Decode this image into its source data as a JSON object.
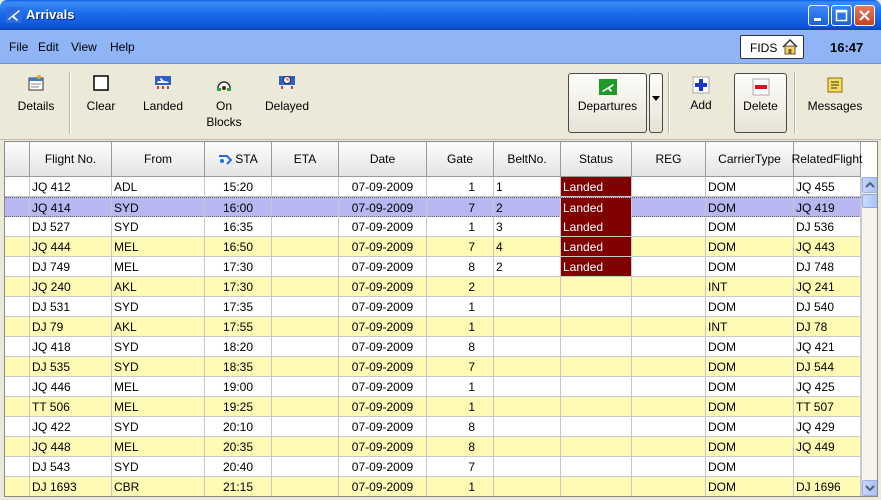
{
  "window": {
    "title": "Arrivals"
  },
  "menu": [
    "File",
    "Edit",
    "View",
    "Help"
  ],
  "fids_label": "FIDS",
  "clock": "16:47",
  "toolbar": {
    "details": "Details",
    "clear": "Clear",
    "landed": "Landed",
    "on_blocks_1": "On",
    "on_blocks_2": "Blocks",
    "delayed": "Delayed",
    "departures": "Departures",
    "add": "Add",
    "delete": "Delete",
    "messages": "Messages"
  },
  "columns": {
    "flight": "Flight No.",
    "from": "From",
    "sta": "STA",
    "eta": "ETA",
    "date": "Date",
    "gate": "Gate",
    "belt_1": "Belt",
    "belt_2": "No.",
    "status": "Status",
    "reg": "REG",
    "carrier_1": "Carrier",
    "carrier_2": "Type",
    "related_1": "Related",
    "related_2": "Flight"
  },
  "rows": [
    {
      "flight": "JQ 412",
      "from": "ADL",
      "sta": "15:20",
      "eta": "",
      "date": "07-09-2009",
      "gate": "1",
      "belt": "1",
      "status": "Landed",
      "reg": "",
      "carrier": "DOM",
      "related": "JQ 455",
      "style": "white"
    },
    {
      "flight": "JQ 414",
      "from": "SYD",
      "sta": "16:00",
      "eta": "",
      "date": "07-09-2009",
      "gate": "7",
      "belt": "2",
      "status": "Landed",
      "reg": "",
      "carrier": "DOM",
      "related": "JQ 419",
      "style": "selected"
    },
    {
      "flight": "DJ 527",
      "from": "SYD",
      "sta": "16:35",
      "eta": "",
      "date": "07-09-2009",
      "gate": "1",
      "belt": "3",
      "status": "Landed",
      "reg": "",
      "carrier": "DOM",
      "related": "DJ 536",
      "style": "white"
    },
    {
      "flight": "JQ 444",
      "from": "MEL",
      "sta": "16:50",
      "eta": "",
      "date": "07-09-2009",
      "gate": "7",
      "belt": "4",
      "status": "Landed",
      "reg": "",
      "carrier": "DOM",
      "related": "JQ 443",
      "style": "yellow"
    },
    {
      "flight": "DJ 749",
      "from": "MEL",
      "sta": "17:30",
      "eta": "",
      "date": "07-09-2009",
      "gate": "8",
      "belt": "2",
      "status": "Landed",
      "reg": "",
      "carrier": "DOM",
      "related": "DJ 748",
      "style": "white"
    },
    {
      "flight": "JQ 240",
      "from": "AKL",
      "sta": "17:30",
      "eta": "",
      "date": "07-09-2009",
      "gate": "2",
      "belt": "",
      "status": "",
      "reg": "",
      "carrier": "INT",
      "related": "JQ 241",
      "style": "yellow"
    },
    {
      "flight": "DJ 531",
      "from": "SYD",
      "sta": "17:35",
      "eta": "",
      "date": "07-09-2009",
      "gate": "1",
      "belt": "",
      "status": "",
      "reg": "",
      "carrier": "DOM",
      "related": "DJ 540",
      "style": "white"
    },
    {
      "flight": "DJ 79",
      "from": "AKL",
      "sta": "17:55",
      "eta": "",
      "date": "07-09-2009",
      "gate": "1",
      "belt": "",
      "status": "",
      "reg": "",
      "carrier": "INT",
      "related": "DJ 78",
      "style": "yellow"
    },
    {
      "flight": "JQ 418",
      "from": "SYD",
      "sta": "18:20",
      "eta": "",
      "date": "07-09-2009",
      "gate": "8",
      "belt": "",
      "status": "",
      "reg": "",
      "carrier": "DOM",
      "related": "JQ 421",
      "style": "white"
    },
    {
      "flight": "DJ 535",
      "from": "SYD",
      "sta": "18:35",
      "eta": "",
      "date": "07-09-2009",
      "gate": "7",
      "belt": "",
      "status": "",
      "reg": "",
      "carrier": "DOM",
      "related": "DJ 544",
      "style": "yellow"
    },
    {
      "flight": "JQ 446",
      "from": "MEL",
      "sta": "19:00",
      "eta": "",
      "date": "07-09-2009",
      "gate": "1",
      "belt": "",
      "status": "",
      "reg": "",
      "carrier": "DOM",
      "related": "JQ 425",
      "style": "white"
    },
    {
      "flight": "TT 506",
      "from": "MEL",
      "sta": "19:25",
      "eta": "",
      "date": "07-09-2009",
      "gate": "1",
      "belt": "",
      "status": "",
      "reg": "",
      "carrier": "DOM",
      "related": "TT 507",
      "style": "yellow"
    },
    {
      "flight": "JQ 422",
      "from": "SYD",
      "sta": "20:10",
      "eta": "",
      "date": "07-09-2009",
      "gate": "8",
      "belt": "",
      "status": "",
      "reg": "",
      "carrier": "DOM",
      "related": "JQ 429",
      "style": "white"
    },
    {
      "flight": "JQ 448",
      "from": "MEL",
      "sta": "20:35",
      "eta": "",
      "date": "07-09-2009",
      "gate": "8",
      "belt": "",
      "status": "",
      "reg": "",
      "carrier": "DOM",
      "related": "JQ 449",
      "style": "yellow"
    },
    {
      "flight": "DJ 543",
      "from": "SYD",
      "sta": "20:40",
      "eta": "",
      "date": "07-09-2009",
      "gate": "7",
      "belt": "",
      "status": "",
      "reg": "",
      "carrier": "DOM",
      "related": "",
      "style": "white"
    },
    {
      "flight": "DJ 1693",
      "from": "CBR",
      "sta": "21:15",
      "eta": "",
      "date": "07-09-2009",
      "gate": "1",
      "belt": "",
      "status": "",
      "reg": "",
      "carrier": "DOM",
      "related": "DJ 1696",
      "style": "yellow"
    }
  ],
  "colors": {
    "titlebar": "#0D55D6",
    "menubar": "#8FB5F6",
    "row_alt": "#FFFBB5",
    "selected": "#B9B7F1",
    "landed": "#800000"
  }
}
